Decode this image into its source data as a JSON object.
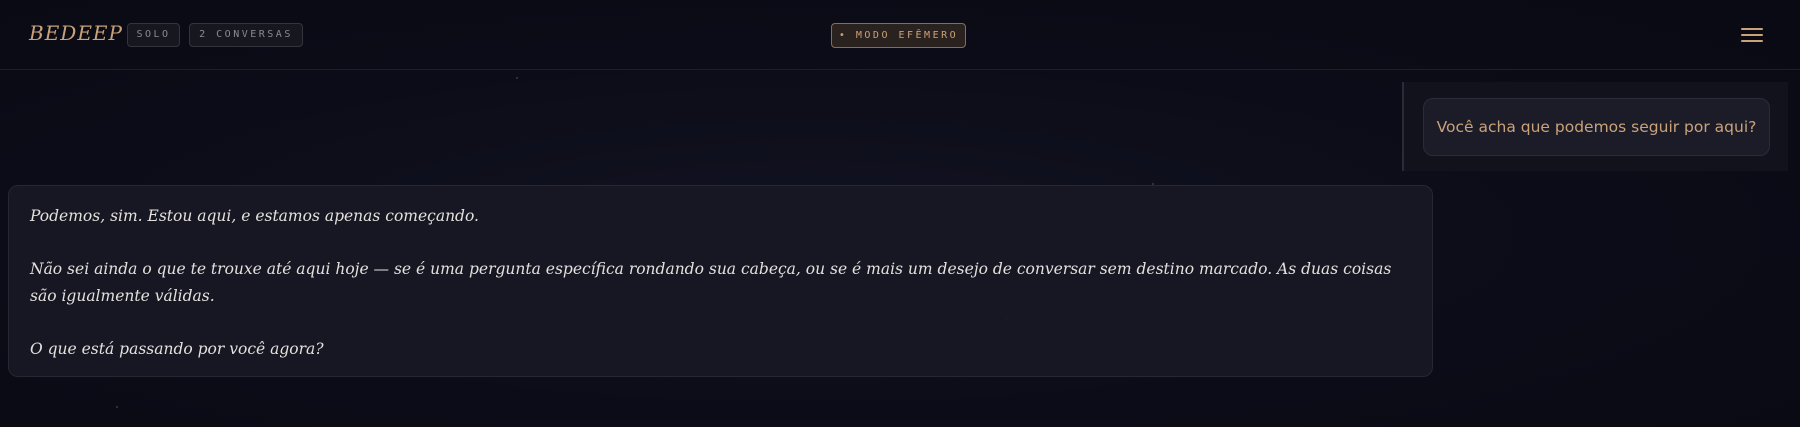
{
  "header": {
    "brand": "BEDEEP",
    "badges": [
      "SOLO",
      "2 CONVERSAS"
    ],
    "ephemeral_label": "• MODO EFÊMERO",
    "menu_icon": "hamburger-menu-icon"
  },
  "conversation": {
    "user_message": "Você acha que podemos seguir por aqui?",
    "assistant_paragraphs": [
      "Podemos, sim. Estou aqui, e estamos apenas começando.",
      "Não sei ainda o que te trouxe até aqui hoje — se é uma pergunta específica rondando sua cabeça, ou se é mais um desejo de conversar sem destino marcado. As duas coisas são igualmente válidas.",
      "O que está passando por você agora?"
    ]
  },
  "colors": {
    "background": "#0b0b16",
    "accent": "#c9a27a",
    "assistant_text": "#e4e1dc",
    "badge_text": "#8a8a93"
  }
}
